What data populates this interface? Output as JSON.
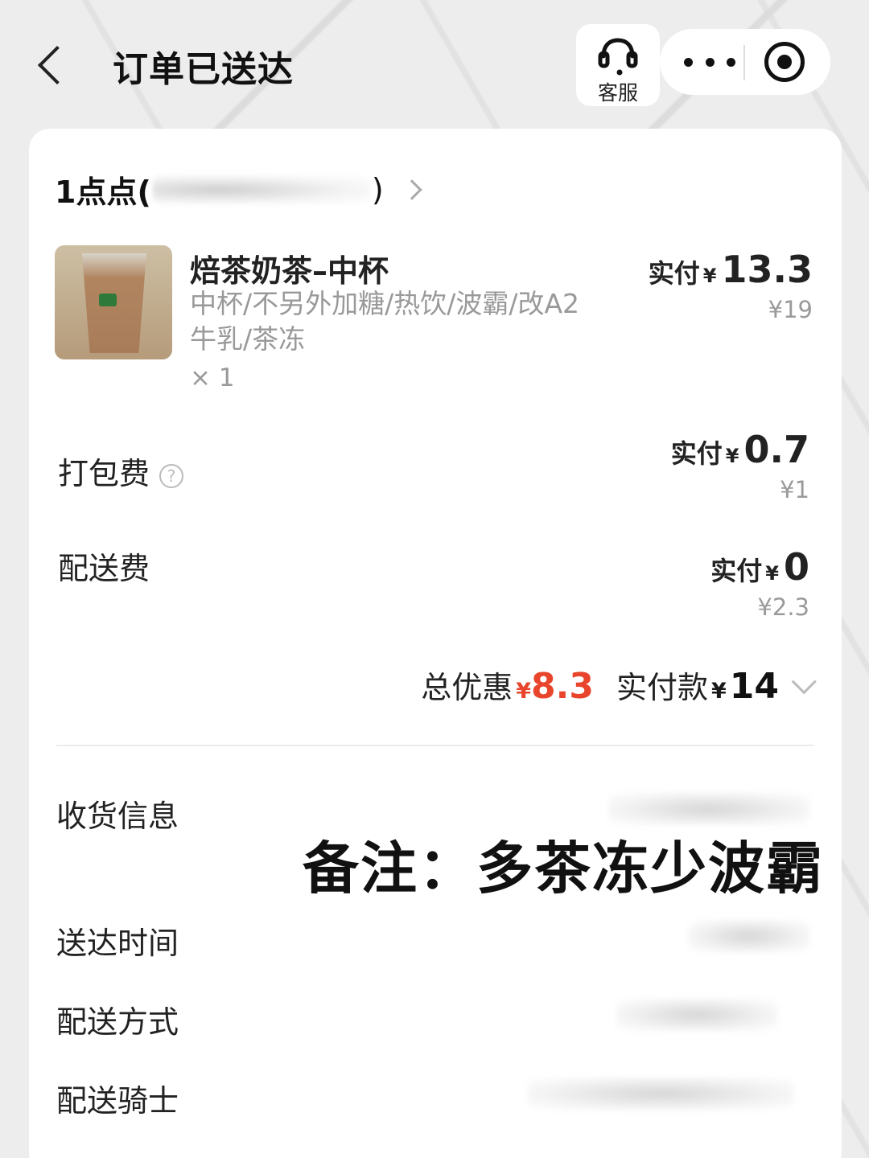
{
  "header": {
    "title": "订单已送达",
    "service_label": "客服"
  },
  "shop": {
    "name": "1点点(",
    "close_paren": ")"
  },
  "product": {
    "name": "焙茶奶茶–中杯",
    "spec": "中杯/不另外加糖/热饮/波霸/改A2牛乳/茶冻",
    "qty": "× 1",
    "paid_label": "实付",
    "yen": "¥",
    "paid": "13.3",
    "original": "¥19"
  },
  "fees": [
    {
      "label": "打包费",
      "paid_label": "实付",
      "yen": "¥",
      "paid": "0.7",
      "original": "¥1",
      "help_icon": "?"
    },
    {
      "label": "配送费",
      "paid_label": "实付",
      "yen": "¥",
      "paid": "0",
      "original": "¥2.3"
    }
  ],
  "totals": {
    "discount_label": "总优惠",
    "yen": "¥",
    "discount": "8.3",
    "total_label": "实付款",
    "total": "14"
  },
  "info": {
    "receive": "收货信息",
    "time": "送达时间",
    "method": "配送方式",
    "rider": "配送骑士"
  },
  "overlay_note": "备注：多茶冻少波霸",
  "colors": {
    "accent_red": "#e8452c",
    "card_bg": "#ffffff",
    "page_bg": "#ececec"
  },
  "icons": {
    "back": "chevron-left-icon",
    "service": "headset-icon",
    "more": "more-dots-icon",
    "target": "target-icon"
  }
}
